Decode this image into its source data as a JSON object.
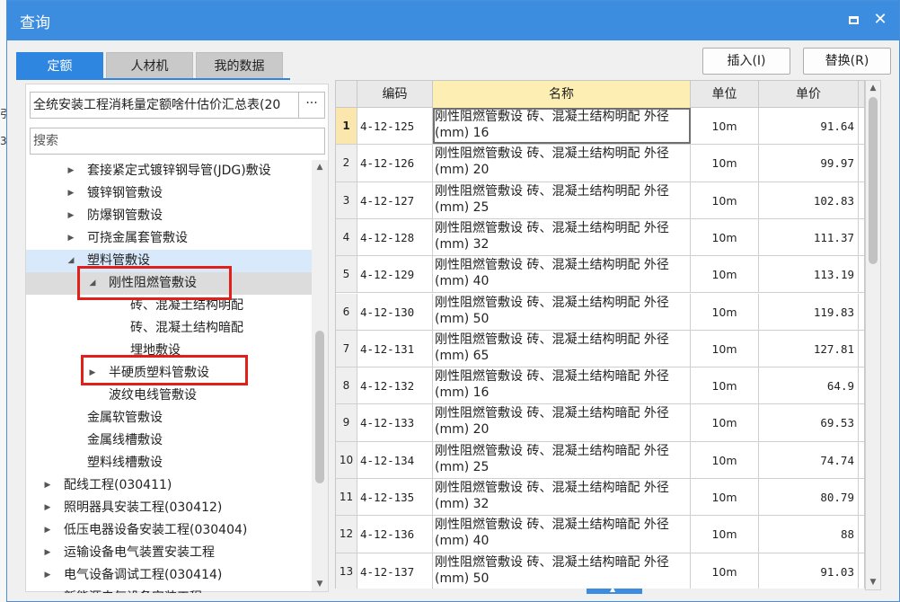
{
  "dialog": {
    "title": "查询",
    "maximize_icon": "maximize-icon",
    "close_icon": "close-icon",
    "close_glyph": "✕"
  },
  "tabs": [
    {
      "label": "定额",
      "active": true
    },
    {
      "label": "人材机",
      "active": false
    },
    {
      "label": "我的数据",
      "active": false
    }
  ],
  "actions": {
    "insert_label": "插入(I)",
    "replace_label": "替换(R)"
  },
  "library": {
    "selected": "全统安装工程消耗量定额啥什估价汇总表(20",
    "more_label": "···"
  },
  "search": {
    "placeholder": "搜索",
    "value": ""
  },
  "tree": [
    {
      "label": "套接紧定式镀锌钢导管(JDG)敷设",
      "level": 3,
      "arrow": "▶"
    },
    {
      "label": "镀锌钢管敷设",
      "level": 3,
      "arrow": "▶"
    },
    {
      "label": "防爆钢管敷设",
      "level": 3,
      "arrow": "▶"
    },
    {
      "label": "可挠金属套管敷设",
      "level": 3,
      "arrow": "▶"
    },
    {
      "label": "塑料管敷设",
      "level": 3,
      "arrow": "◢",
      "state": "hover"
    },
    {
      "label": "刚性阻燃管敷设",
      "level": 4,
      "arrow": "◢",
      "state": "selected"
    },
    {
      "label": "砖、混凝土结构明配",
      "level": 6,
      "arrow": ""
    },
    {
      "label": "砖、混凝土结构暗配",
      "level": 6,
      "arrow": ""
    },
    {
      "label": "埋地敷设",
      "level": 6,
      "arrow": ""
    },
    {
      "label": "半硬质塑料管敷设",
      "level": 4,
      "arrow": "▶"
    },
    {
      "label": "波纹电线管敷设",
      "level": 4,
      "arrow": ""
    },
    {
      "label": "金属软管敷设",
      "level": 3,
      "arrow": ""
    },
    {
      "label": "金属线槽敷设",
      "level": 3,
      "arrow": ""
    },
    {
      "label": "塑料线槽敷设",
      "level": 3,
      "arrow": ""
    },
    {
      "label": "配线工程(030411)",
      "level": 1,
      "arrow": "▶"
    },
    {
      "label": "照明器具安装工程(030412)",
      "level": 1,
      "arrow": "▶"
    },
    {
      "label": "低压电器设备安装工程(030404)",
      "level": 1,
      "arrow": "▶"
    },
    {
      "label": "运输设备电气装置安装工程",
      "level": 1,
      "arrow": "▶"
    },
    {
      "label": "电气设备调试工程(030414)",
      "level": 1,
      "arrow": "▶"
    },
    {
      "label": "新能源电气设备安装工程",
      "level": 1,
      "arrow": "▶"
    }
  ],
  "grid": {
    "columns": [
      "编码",
      "名称",
      "单位",
      "单价"
    ],
    "rows": [
      {
        "idx": "1",
        "code": "4-12-125",
        "name": "刚性阻燃管敷设 砖、混凝土结构明配 外径(mm) 16",
        "unit": "10m",
        "price": "91.64"
      },
      {
        "idx": "2",
        "code": "4-12-126",
        "name": "刚性阻燃管敷设 砖、混凝土结构明配 外径(mm) 20",
        "unit": "10m",
        "price": "99.97"
      },
      {
        "idx": "3",
        "code": "4-12-127",
        "name": "刚性阻燃管敷设 砖、混凝土结构明配 外径(mm) 25",
        "unit": "10m",
        "price": "102.83"
      },
      {
        "idx": "4",
        "code": "4-12-128",
        "name": "刚性阻燃管敷设 砖、混凝土结构明配 外径(mm) 32",
        "unit": "10m",
        "price": "111.37"
      },
      {
        "idx": "5",
        "code": "4-12-129",
        "name": "刚性阻燃管敷设 砖、混凝土结构明配 外径(mm) 40",
        "unit": "10m",
        "price": "113.19"
      },
      {
        "idx": "6",
        "code": "4-12-130",
        "name": "刚性阻燃管敷设 砖、混凝土结构明配 外径(mm) 50",
        "unit": "10m",
        "price": "119.83"
      },
      {
        "idx": "7",
        "code": "4-12-131",
        "name": "刚性阻燃管敷设 砖、混凝土结构明配 外径(mm) 65",
        "unit": "10m",
        "price": "127.81"
      },
      {
        "idx": "8",
        "code": "4-12-132",
        "name": "刚性阻燃管敷设 砖、混凝土结构暗配 外径(mm) 16",
        "unit": "10m",
        "price": "64.9"
      },
      {
        "idx": "9",
        "code": "4-12-133",
        "name": "刚性阻燃管敷设 砖、混凝土结构暗配 外径(mm) 20",
        "unit": "10m",
        "price": "69.53"
      },
      {
        "idx": "10",
        "code": "4-12-134",
        "name": "刚性阻燃管敷设 砖、混凝土结构暗配 外径(mm) 25",
        "unit": "10m",
        "price": "74.74"
      },
      {
        "idx": "11",
        "code": "4-12-135",
        "name": "刚性阻燃管敷设 砖、混凝土结构暗配 外径(mm) 32",
        "unit": "10m",
        "price": "80.79"
      },
      {
        "idx": "12",
        "code": "4-12-136",
        "name": "刚性阻燃管敷设 砖、混凝土结构暗配 外径(mm) 40",
        "unit": "10m",
        "price": "88"
      },
      {
        "idx": "13",
        "code": "4-12-137",
        "name": "刚性阻燃管敷设 砖、混凝土结构暗配 外径(mm) 50",
        "unit": "10m",
        "price": "91.03"
      }
    ]
  },
  "background": {
    "left_glyphs": [
      "引",
      "3"
    ]
  },
  "colors": {
    "titlebar": "#3c8ce0",
    "active_tab": "#2f86e0",
    "highlight_box": "#e0201b",
    "active_header": "#fdeeb4"
  }
}
